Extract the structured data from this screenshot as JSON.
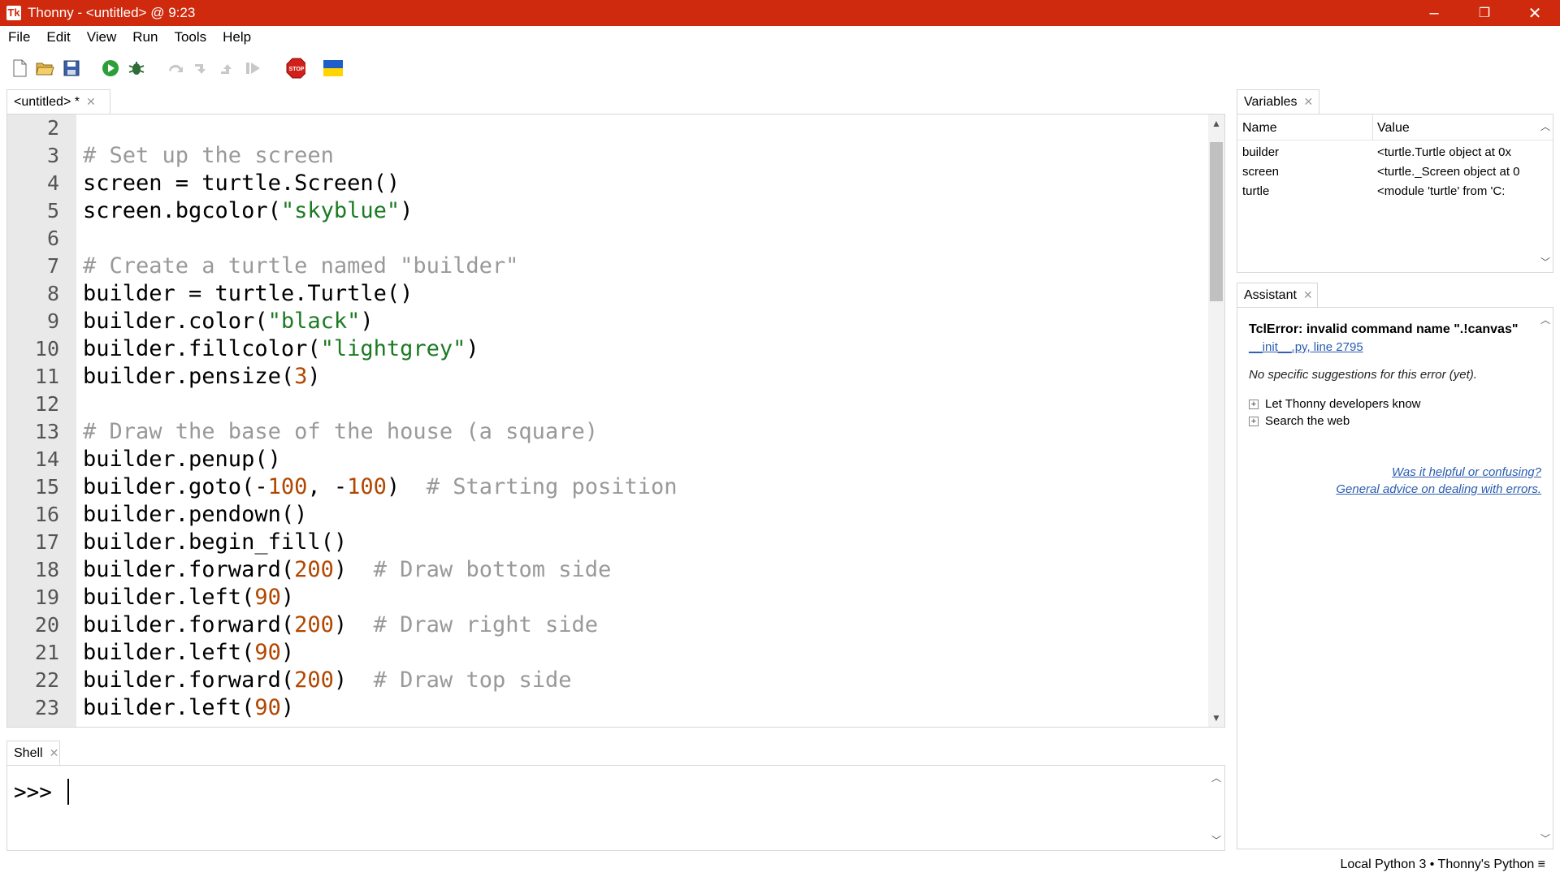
{
  "window": {
    "title": "Thonny - <untitled> @ 9:23",
    "minimize_glyph": "–",
    "restore_glyph": "❐",
    "close_glyph": "✕"
  },
  "menu": [
    "File",
    "Edit",
    "View",
    "Run",
    "Tools",
    "Help"
  ],
  "toolbar": {
    "icons": [
      "new-file-icon",
      "open-file-icon",
      "save-icon",
      "run-icon",
      "debug-icon",
      "step-over-icon",
      "step-into-icon",
      "step-out-icon",
      "resume-icon",
      "stop-icon",
      "ukraine-flag-icon"
    ],
    "stop_label": "STOP"
  },
  "editor": {
    "tab_label": "<untitled> *",
    "lines": [
      {
        "n": "2",
        "segments": []
      },
      {
        "n": "3",
        "segments": [
          {
            "t": "# Set up the screen",
            "c": "cm"
          }
        ]
      },
      {
        "n": "4",
        "segments": [
          {
            "t": "screen = turtle.Screen()",
            "c": ""
          }
        ]
      },
      {
        "n": "5",
        "segments": [
          {
            "t": "screen.bgcolor(",
            "c": ""
          },
          {
            "t": "\"skyblue\"",
            "c": "str"
          },
          {
            "t": ")",
            "c": ""
          }
        ]
      },
      {
        "n": "6",
        "segments": []
      },
      {
        "n": "7",
        "segments": [
          {
            "t": "# Create a turtle named \"builder\"",
            "c": "cm"
          }
        ]
      },
      {
        "n": "8",
        "segments": [
          {
            "t": "builder = turtle.Turtle()",
            "c": ""
          }
        ]
      },
      {
        "n": "9",
        "segments": [
          {
            "t": "builder.color(",
            "c": ""
          },
          {
            "t": "\"black\"",
            "c": "str"
          },
          {
            "t": ")",
            "c": ""
          }
        ]
      },
      {
        "n": "10",
        "segments": [
          {
            "t": "builder.fillcolor(",
            "c": ""
          },
          {
            "t": "\"lightgrey\"",
            "c": "str"
          },
          {
            "t": ")",
            "c": ""
          }
        ]
      },
      {
        "n": "11",
        "segments": [
          {
            "t": "builder.pensize(",
            "c": ""
          },
          {
            "t": "3",
            "c": "num"
          },
          {
            "t": ")",
            "c": ""
          }
        ]
      },
      {
        "n": "12",
        "segments": []
      },
      {
        "n": "13",
        "segments": [
          {
            "t": "# Draw the base of the house (a square)",
            "c": "cm"
          }
        ]
      },
      {
        "n": "14",
        "segments": [
          {
            "t": "builder.penup()",
            "c": ""
          }
        ]
      },
      {
        "n": "15",
        "segments": [
          {
            "t": "builder.goto(-",
            "c": ""
          },
          {
            "t": "100",
            "c": "num"
          },
          {
            "t": ", -",
            "c": ""
          },
          {
            "t": "100",
            "c": "num"
          },
          {
            "t": ")  ",
            "c": ""
          },
          {
            "t": "# Starting position",
            "c": "cm"
          }
        ]
      },
      {
        "n": "16",
        "segments": [
          {
            "t": "builder.pendown()",
            "c": ""
          }
        ]
      },
      {
        "n": "17",
        "segments": [
          {
            "t": "builder.begin_fill()",
            "c": ""
          }
        ]
      },
      {
        "n": "18",
        "segments": [
          {
            "t": "builder.forward(",
            "c": ""
          },
          {
            "t": "200",
            "c": "num"
          },
          {
            "t": ")  ",
            "c": ""
          },
          {
            "t": "# Draw bottom side",
            "c": "cm"
          }
        ]
      },
      {
        "n": "19",
        "segments": [
          {
            "t": "builder.left(",
            "c": ""
          },
          {
            "t": "90",
            "c": "num"
          },
          {
            "t": ")",
            "c": ""
          }
        ]
      },
      {
        "n": "20",
        "segments": [
          {
            "t": "builder.forward(",
            "c": ""
          },
          {
            "t": "200",
            "c": "num"
          },
          {
            "t": ")  ",
            "c": ""
          },
          {
            "t": "# Draw right side",
            "c": "cm"
          }
        ]
      },
      {
        "n": "21",
        "segments": [
          {
            "t": "builder.left(",
            "c": ""
          },
          {
            "t": "90",
            "c": "num"
          },
          {
            "t": ")",
            "c": ""
          }
        ]
      },
      {
        "n": "22",
        "segments": [
          {
            "t": "builder.forward(",
            "c": ""
          },
          {
            "t": "200",
            "c": "num"
          },
          {
            "t": ")  ",
            "c": ""
          },
          {
            "t": "# Draw top side",
            "c": "cm"
          }
        ]
      },
      {
        "n": "23",
        "segments": [
          {
            "t": "builder.left(",
            "c": ""
          },
          {
            "t": "90",
            "c": "num"
          },
          {
            "t": ")",
            "c": ""
          }
        ]
      }
    ]
  },
  "variables": {
    "tab_label": "Variables",
    "col_name": "Name",
    "col_value": "Value",
    "rows": [
      {
        "name": "builder",
        "value": "<turtle.Turtle object at 0x"
      },
      {
        "name": "screen",
        "value": "<turtle._Screen object at 0"
      },
      {
        "name": "turtle",
        "value": "<module 'turtle' from 'C:"
      }
    ]
  },
  "assistant": {
    "tab_label": "Assistant",
    "error_title": "TclError: invalid command name \".!canvas\"",
    "error_location": "__init__.py, line 2795",
    "note": "No specific suggestions for this error (yet).",
    "expanders": [
      "Let Thonny developers know",
      "Search the web"
    ],
    "feedback_link": "Was it helpful or confusing?",
    "advice_link": "General advice on dealing with errors."
  },
  "shell": {
    "tab_label": "Shell",
    "prompt": ">>>"
  },
  "status": {
    "interpreter": "Local Python 3  •  Thonny's Python  ≡"
  },
  "colors": {
    "titlebar": "#cf2a0e",
    "comment": "#999999",
    "string": "#1b7a22",
    "number": "#b14700",
    "link": "#2a5db0"
  }
}
